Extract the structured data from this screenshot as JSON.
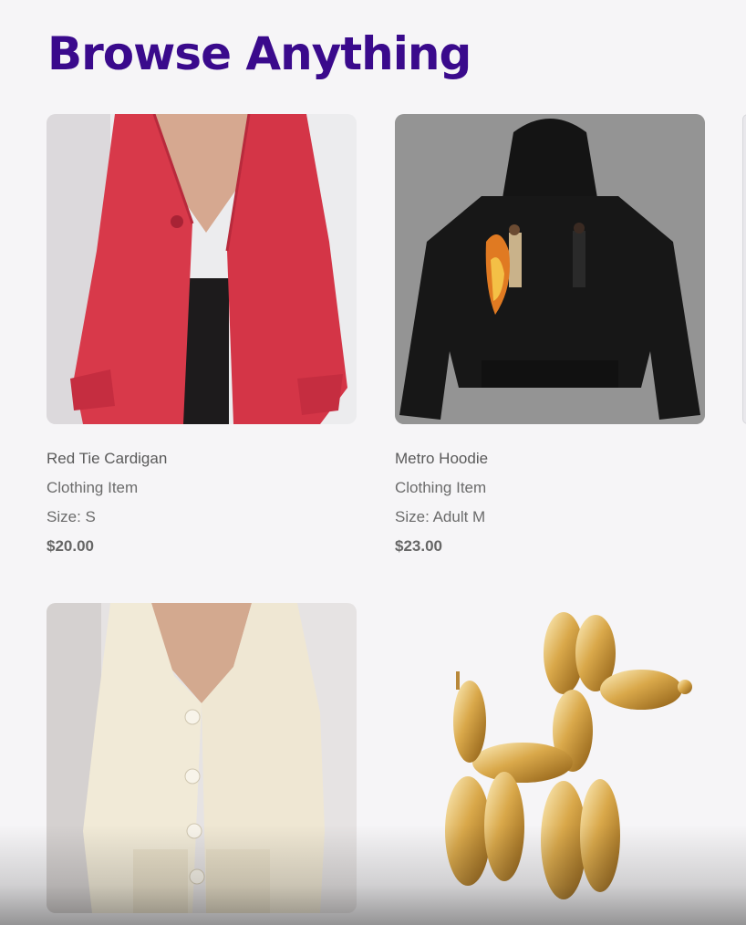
{
  "page": {
    "title": "Browse Anything"
  },
  "products": [
    {
      "name": "Red Tie Cardigan",
      "category": "Clothing Item",
      "size": "Size: S",
      "price": "$20.00",
      "image": "red-cardigan-image"
    },
    {
      "name": "Metro Hoodie",
      "category": "Clothing Item",
      "size": "Size: Adult M",
      "price": "$23.00",
      "image": "black-hoodie-image"
    },
    {
      "image": "cream-cardigan-image"
    },
    {
      "image": "gold-balloon-dog-image"
    }
  ],
  "colors": {
    "title": "#3a0a8c",
    "background": "#f6f5f7"
  }
}
